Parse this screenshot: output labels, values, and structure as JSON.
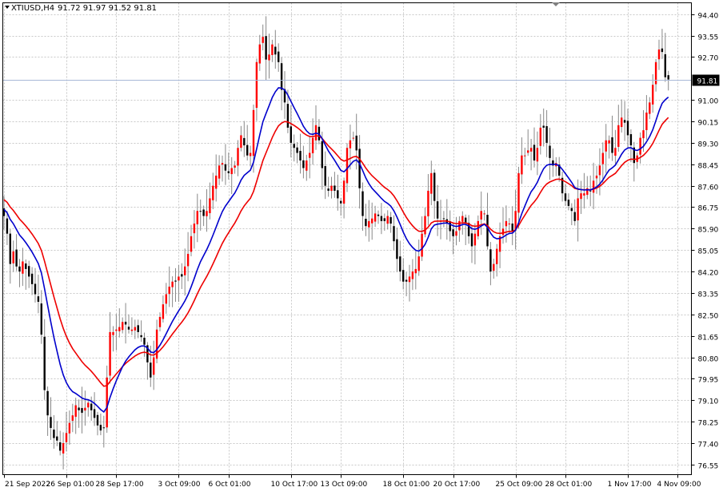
{
  "header": {
    "symbol_timeframe": "XTIUSD,H4",
    "ohlc": "91.72 91.97 91.52 91.81"
  },
  "colors": {
    "background": "#ffffff",
    "grid": "#c8c8c8",
    "axis": "#000000",
    "bull_candle": "#ff0000",
    "bear_candle": "#000000",
    "wick": "#888888",
    "ma_fast": "#0000cc",
    "ma_slow": "#ee0000",
    "price_line": "#a8b8d8",
    "price_label_bg": "#000000",
    "price_label_text": "#ffffff"
  },
  "chart_data": {
    "type": "candlestick",
    "title": "",
    "ylim": [
      76.15,
      94.85
    ],
    "y_ticks": [
      "94.40",
      "93.55",
      "92.70",
      "91.81",
      "91.00",
      "90.15",
      "89.30",
      "88.45",
      "87.60",
      "86.75",
      "85.90",
      "85.05",
      "84.20",
      "83.35",
      "82.50",
      "81.65",
      "80.80",
      "79.95",
      "79.10",
      "78.25",
      "77.40",
      "76.55"
    ],
    "x_ticks": [
      {
        "label": "21 Sep 2022",
        "i": 0
      },
      {
        "label": "26 Sep 01:00",
        "i": 20
      },
      {
        "label": "28 Sep 17:00",
        "i": 36
      },
      {
        "label": "3 Oct 09:00",
        "i": 56
      },
      {
        "label": "6 Oct 01:00",
        "i": 72
      },
      {
        "label": "10 Oct 17:00",
        "i": 92
      },
      {
        "label": "13 Oct 09:00",
        "i": 108
      },
      {
        "label": "18 Oct 01:00",
        "i": 128
      },
      {
        "label": "20 Oct 17:00",
        "i": 144
      },
      {
        "label": "25 Oct 09:00",
        "i": 164
      },
      {
        "label": "28 Oct 01:00",
        "i": 180
      },
      {
        "label": "1 Nov 17:00",
        "i": 200
      },
      {
        "label": "4 Nov 09:00",
        "i": 216
      }
    ],
    "current_price": 91.81,
    "current_price_label": "91.81",
    "closes": [
      86.4,
      85.7,
      84.5,
      85.0,
      84.4,
      84.2,
      84.6,
      84.3,
      84.0,
      83.7,
      83.3,
      83.0,
      81.7,
      79.5,
      78.5,
      78.0,
      77.6,
      77.5,
      77.1,
      77.4,
      77.8,
      78.2,
      78.5,
      78.9,
      78.7,
      78.6,
      78.8,
      79.0,
      78.7,
      78.4,
      78.1,
      77.9,
      78.0,
      80.0,
      81.8,
      81.8,
      81.9,
      82.0,
      82.2,
      82.1,
      81.9,
      81.9,
      82.0,
      81.8,
      81.6,
      81.3,
      80.6,
      80.0,
      80.8,
      81.9,
      82.4,
      82.9,
      83.3,
      83.6,
      83.8,
      83.8,
      84.0,
      84.0,
      84.4,
      84.9,
      85.6,
      86.1,
      86.6,
      86.6,
      86.4,
      86.6,
      87.1,
      87.6,
      88.0,
      88.4,
      88.5,
      88.2,
      88.1,
      88.3,
      88.4,
      89.1,
      89.6,
      89.2,
      88.8,
      88.9,
      90.6,
      92.5,
      93.2,
      93.5,
      92.6,
      92.8,
      93.2,
      92.8,
      92.5,
      91.4,
      90.9,
      89.9,
      89.3,
      89.1,
      88.9,
      88.6,
      88.3,
      88.6,
      88.9,
      89.5,
      90.0,
      89.4,
      88.3,
      87.6,
      87.4,
      87.6,
      87.4,
      87.1,
      86.9,
      87.8,
      89.1,
      89.4,
      89.5,
      89.0,
      87.5,
      86.4,
      86.0,
      86.2,
      86.3,
      86.5,
      86.4,
      86.2,
      86.2,
      86.4,
      86.1,
      85.4,
      84.7,
      84.2,
      83.8,
      83.8,
      84.0,
      84.2,
      84.3,
      84.8,
      85.7,
      86.4,
      87.4,
      88.1,
      87.0,
      86.3,
      86.2,
      86.3,
      86.1,
      85.8,
      85.6,
      85.8,
      86.2,
      86.4,
      86.1,
      85.6,
      85.2,
      85.7,
      86.2,
      86.6,
      86.5,
      85.2,
      84.2,
      84.5,
      85.1,
      85.6,
      85.9,
      86.2,
      86.1,
      85.8,
      86.6,
      88.1,
      88.8,
      88.8,
      89.0,
      89.1,
      88.6,
      89.1,
      89.9,
      89.9,
      89.3,
      88.7,
      88.4,
      88.5,
      88.0,
      87.3,
      87.0,
      86.8,
      86.6,
      86.2,
      87.1,
      87.3,
      87.3,
      87.5,
      87.4,
      87.8,
      88.0,
      88.4,
      88.9,
      89.4,
      89.4,
      88.9,
      89.1,
      90.0,
      90.3,
      90.1,
      89.6,
      89.2,
      88.5,
      88.8,
      89.5,
      89.8,
      90.5,
      90.9,
      91.6,
      92.5,
      93.0,
      92.9,
      91.9,
      91.81
    ],
    "ma_fast_period": 14,
    "ma_slow_period": 25,
    "ma_fast_seed": 86.7,
    "ma_slow_seed": 87.1
  }
}
